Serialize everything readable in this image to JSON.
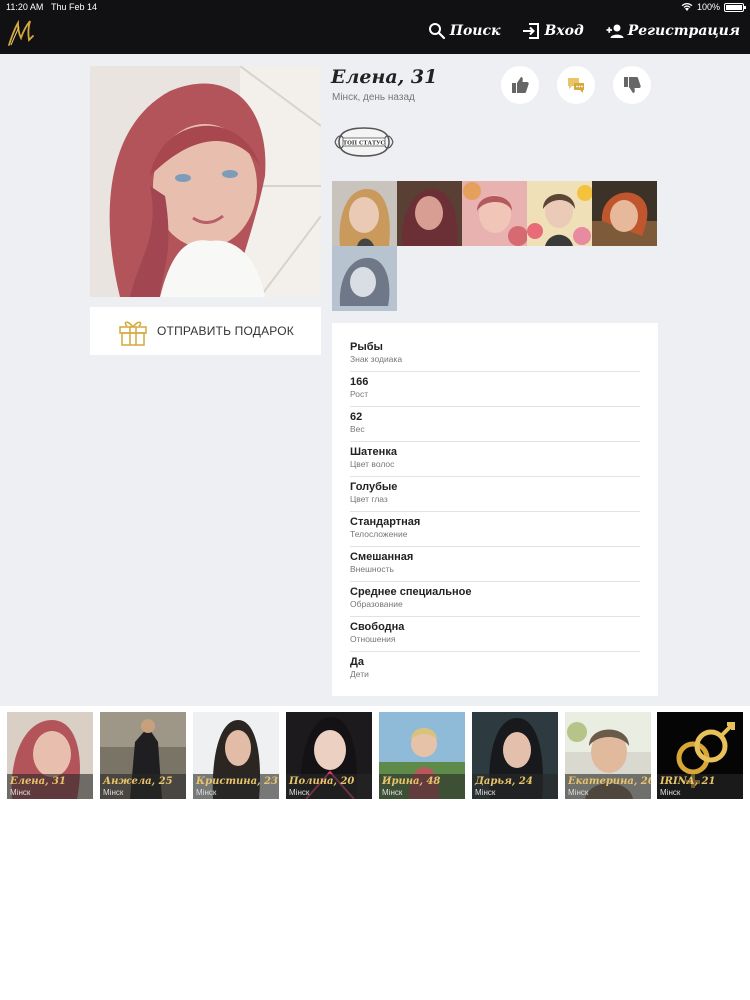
{
  "status": {
    "time": "11:20 AM",
    "date": "Thu Feb 14",
    "battery": "100%"
  },
  "nav": {
    "search": "Поиск",
    "login": "Вход",
    "register": "Регистрация"
  },
  "profile": {
    "name": "Елена, 31",
    "location": "Мінск, день назад",
    "gift_label": "ОТПРАВИТЬ ПОДАРОК",
    "badge_text": "ТОП СТАТУС"
  },
  "colors": {
    "topbar": "#111114",
    "page": "#eeeff2",
    "accent_gold": "#e9c46a"
  },
  "details": [
    {
      "value": "Рыбы",
      "label": "Знак зодиака"
    },
    {
      "value": "166",
      "label": "Рост"
    },
    {
      "value": "62",
      "label": "Вес"
    },
    {
      "value": "Шатенка",
      "label": "Цвет волос"
    },
    {
      "value": "Голубые",
      "label": "Цвет глаз"
    },
    {
      "value": "Стандартная",
      "label": "Телосложение"
    },
    {
      "value": "Смешанная",
      "label": "Внешность"
    },
    {
      "value": "Среднее специальное",
      "label": "Образование"
    },
    {
      "value": "Свободна",
      "label": "Отношения"
    },
    {
      "value": "Да",
      "label": "Дети"
    }
  ],
  "others": [
    {
      "name": "Елена, 31",
      "city": "Мінск"
    },
    {
      "name": "Анжела, 25",
      "city": "Мінск"
    },
    {
      "name": "Кристина, 23",
      "city": "Мінск"
    },
    {
      "name": "Полина, 20",
      "city": "Мінск"
    },
    {
      "name": "Ирина, 48",
      "city": "Мінск"
    },
    {
      "name": "Дарья, 24",
      "city": "Мінск"
    },
    {
      "name": "Екатерина, 26",
      "city": "Мінск"
    },
    {
      "name": "IRINA, 21",
      "city": "Мінск"
    }
  ]
}
